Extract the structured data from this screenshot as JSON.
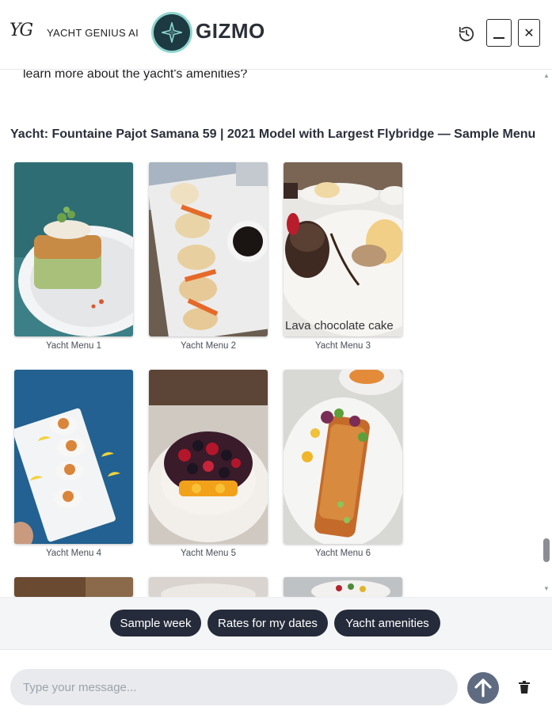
{
  "header": {
    "logo_mark": "YG",
    "brand_name": "YACHT GENIUS AI",
    "app_title": "GIZMO",
    "icons": {
      "history": "history-icon",
      "minimize": "minimize-icon",
      "close": "close-icon",
      "badge": "sparkle-icon"
    }
  },
  "chat": {
    "previous_message_tail": "learn more about the yacht's amenities?",
    "menu_heading": "Yacht: Fountaine Pajot Samana 59 | 2021 Model with Largest Flybridge — Sample Menu",
    "gallery": [
      {
        "caption": "Yacht Menu 1",
        "photo_text": ""
      },
      {
        "caption": "Yacht Menu 2",
        "photo_text": ""
      },
      {
        "caption": "Yacht Menu 3",
        "photo_text": "Lava chocolate cake"
      },
      {
        "caption": "Yacht Menu 4",
        "photo_text": ""
      },
      {
        "caption": "Yacht Menu 5",
        "photo_text": ""
      },
      {
        "caption": "Yacht Menu 6",
        "photo_text": ""
      }
    ]
  },
  "suggestions": [
    {
      "label": "Sample week"
    },
    {
      "label": "Rates for my dates"
    },
    {
      "label": "Yacht amenities"
    }
  ],
  "composer": {
    "placeholder": "Type your message...",
    "value": "",
    "icons": {
      "send": "arrow-up-icon",
      "clear": "trash-icon"
    }
  },
  "colors": {
    "chip_bg": "#252b3a",
    "send_bg": "#5f6b80",
    "badge_bg": "#1d3a42",
    "badge_ring": "#8fd6cf"
  }
}
